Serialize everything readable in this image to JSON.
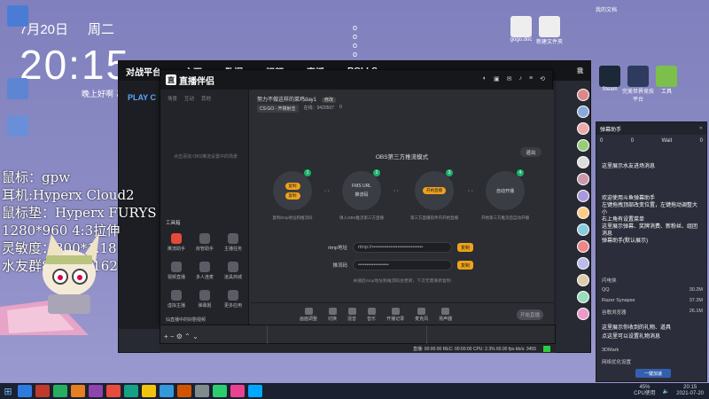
{
  "overlay": {
    "date": "7月20日",
    "weekday": "周二",
    "clock": "20:15",
    "greeting": "晚上好啊 ど",
    "stats": [
      "鼠标：gpw",
      "耳机:Hyperx Cloud2",
      "鼠标垫：Hyperx FURYS",
      "1280*960 4:3拉伸",
      "灵敏度：800*1.18",
      "水友群897245162"
    ]
  },
  "desktop": {
    "top_icons": [
      {
        "label": "gogo.doc",
        "color": "#e8e8e8"
      },
      {
        "label": "新建文件夹",
        "color": "#e8e8e8"
      }
    ],
    "right_icons": [
      {
        "label": "我的文档",
        "color": "#5a8be8"
      },
      {
        "label": "Steam",
        "color": "#223"
      },
      {
        "label": "完美世界竞技平台",
        "color": "#3b6"
      },
      {
        "label": "工具",
        "color": "#8c4"
      }
    ]
  },
  "back_window": {
    "nav": [
      "主页",
      "数据",
      "视频",
      "直播",
      "ROLLS",
      "我"
    ],
    "play_label": "PLAY C",
    "brand": "对战平台"
  },
  "app": {
    "brand": "直播伴侣",
    "window_icons": [
      "skin-icon",
      "gift-icon",
      "notice-icon",
      "bell-icon",
      "menu-icon",
      "share-icon"
    ],
    "left_tabs": [
      "场景",
      "互动",
      "其他"
    ],
    "left_empty": "点击添加 OBS推流设置中的场景",
    "tools_heading": "工具箱",
    "tools": [
      {
        "name": "推流助手",
        "active": true
      },
      {
        "name": "房管助手",
        "active": false
      },
      {
        "name": "主播任务",
        "active": false
      },
      {
        "name": "视频直播",
        "active": false
      },
      {
        "name": "多人连麦",
        "active": false
      },
      {
        "name": "道具商城",
        "active": false
      },
      {
        "name": "虚拟主播",
        "active": false
      },
      {
        "name": "弹幕姬",
        "active": false
      },
      {
        "name": "更多应用",
        "active": false
      }
    ],
    "stream_title": "努力不做这样的菜鸡day1",
    "stream_title_tag": "修改",
    "stream_game": "CS:GO - 开镜射击",
    "stream_online": "0",
    "stream_room": "在线：9420507",
    "obs_mode_title": "OBS第三方推流模式",
    "exit_label": "退出",
    "steps": [
      {
        "n": "1",
        "line1": "复制",
        "line2": "复制",
        "desc": "复制rtmp地址和推流码",
        "highlight": true
      },
      {
        "n": "2",
        "line1": "FMS URL",
        "line2": "推流码",
        "desc": "填入OBS推流第三方直播",
        "highlight": false
      },
      {
        "n": "3",
        "line1": "开始直播",
        "line2": "",
        "desc": "第三方直播软件内开始直播",
        "highlight": true
      },
      {
        "n": "4",
        "line1": "自动开播",
        "line2": "",
        "desc": "开始第三方推流后自动开播",
        "highlight": false
      }
    ],
    "rtmp_label": "rtmp地址",
    "rtmp_value": "rtmp://••••••••••••••••••••••••••••••",
    "key_label": "推流码",
    "key_value": "••••••••••••••••••",
    "copy_label": "复制",
    "tip": "关播后rtmp地址和推流码会更新，下次无需重新复制",
    "bottom_tools": [
      "画面调整",
      "切换",
      "混音",
      "音乐",
      "开播记录",
      "麦克风",
      "扬声器"
    ],
    "start_button": "开始直播",
    "promo": "仙直播中的好剧视频"
  },
  "obs_status": "直播: 00:00:00  REC: 00:00:00  CPU: 2.3%  60.00 fps  kb/s: 3455",
  "chat": {
    "title": "弹幕助手",
    "counts": [
      "0",
      "0",
      "Wait",
      "0"
    ],
    "messages": [
      "这里展示水友进场消息",
      "欢迎使用斗鱼弹幕助手",
      "左键拖拽顶部改变位置，左键拖动调整大小",
      "右上角有设置菜单",
      "这里展示弹幕、奖牌消费、新粉丝、组团消息",
      "弹幕助手(默认展示)",
      "这里展示你收到的礼物、道具",
      "点这里可以设置礼物消息"
    ],
    "list": [
      {
        "name": "闪电侠",
        "v": ""
      },
      {
        "name": "QQ",
        "v": "30.2M"
      },
      {
        "name": "Razer Synapse",
        "v": "37.2M"
      },
      {
        "name": "谷歌浏览器",
        "v": "26.1M"
      },
      {
        "name": "3DMark",
        "v": ""
      },
      {
        "name": "网络优化设置",
        "v": ""
      }
    ],
    "ok_label": "一键加速"
  },
  "taskbar": {
    "cpu": "45%",
    "cpu_label": "CPU使用",
    "time": "20:15",
    "date": "2021-07-20",
    "apps": [
      "#2e7be0",
      "#c0392b",
      "#27ae60",
      "#e67e22",
      "#8e44ad",
      "#e74c3c",
      "#16a085",
      "#f1c40f",
      "#3498db",
      "#d35400",
      "#7f8c8d",
      "#2ecc71",
      "#e84393",
      "#00a8ff"
    ]
  },
  "colors": {
    "accent": "#f0a21a",
    "green": "#1ab26b"
  }
}
